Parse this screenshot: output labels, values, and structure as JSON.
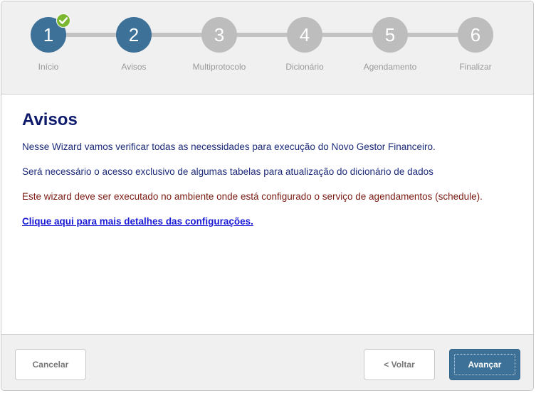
{
  "stepper": {
    "steps": [
      {
        "number": "1",
        "label": "Início",
        "state": "done"
      },
      {
        "number": "2",
        "label": "Avisos",
        "state": "active"
      },
      {
        "number": "3",
        "label": "Multiprotocolo",
        "state": "pending"
      },
      {
        "number": "4",
        "label": "Dicionário",
        "state": "pending"
      },
      {
        "number": "5",
        "label": "Agendamento",
        "state": "pending"
      },
      {
        "number": "6",
        "label": "Finalizar",
        "state": "pending"
      }
    ],
    "completed_icon": "check-icon"
  },
  "content": {
    "title": "Avisos",
    "paragraphs": [
      "Nesse Wizard vamos verificar todas as necessidades para execução do Novo Gestor Financeiro.",
      "Será necessário o acesso exclusivo de algumas tabelas para atualização do dicionário de dados"
    ],
    "warning": "Este wizard deve ser executado no ambiente onde está configurado o serviço de agendamentos (schedule).",
    "link_text": "Clique aqui para mais detalhes das configurações. "
  },
  "footer": {
    "cancel_label": "Cancelar",
    "back_label": "< Voltar",
    "next_label": "Avançar"
  },
  "colors": {
    "accent": "#3d7198",
    "pending_step": "#bdbdbd",
    "title": "#0e1a6b",
    "warning_text": "#7a1a12",
    "link": "#1a1ad6",
    "check_badge": "#7cb82f"
  }
}
